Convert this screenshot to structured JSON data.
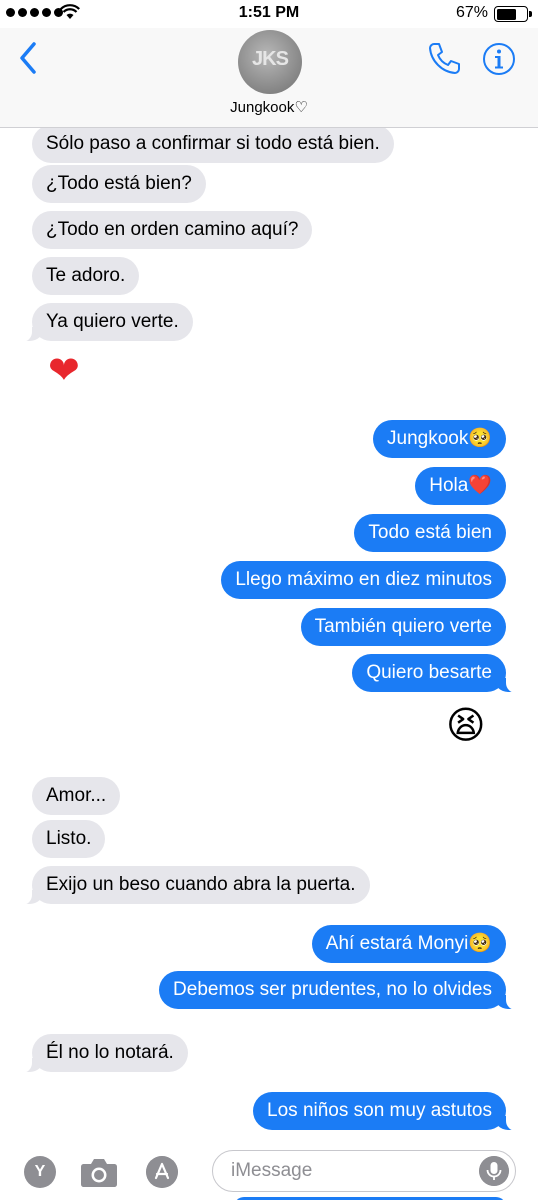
{
  "status_bar": {
    "time": "1:51 PM",
    "battery_percent": "67%",
    "battery_level": 0.67
  },
  "header": {
    "contact_name": "Jungkook♡",
    "avatar_text": "JKS"
  },
  "messages": [
    {
      "side": "in",
      "text": "Sólo paso a confirmar si todo está bien.",
      "top": 0
    },
    {
      "side": "in",
      "text": "¿Todo está bien?"
    },
    {
      "side": "in",
      "text": "¿Todo en orden camino aquí?"
    },
    {
      "side": "in",
      "text": "Te adoro."
    },
    {
      "side": "in",
      "text": "Ya quiero verte."
    },
    {
      "side": "out",
      "text": "Jungkook🥺"
    },
    {
      "side": "out",
      "text": "Hola❤️"
    },
    {
      "side": "out",
      "text": "Todo está bien"
    },
    {
      "side": "out",
      "text": "Llego máximo en diez minutos"
    },
    {
      "side": "out",
      "text": "También quiero verte"
    },
    {
      "side": "out",
      "text": "Quiero besarte"
    },
    {
      "side": "in",
      "text": "Amor..."
    },
    {
      "side": "in",
      "text": "Listo."
    },
    {
      "side": "in",
      "text": "Exijo un beso cuando abra la puerta."
    },
    {
      "side": "out",
      "text": "Ahí estará Monyi🥺"
    },
    {
      "side": "out",
      "text": "Debemos ser prudentes, no lo olvides"
    },
    {
      "side": "in",
      "text": "Él no lo notará."
    },
    {
      "side": "out",
      "text": "Los niños son muy astutos"
    }
  ],
  "emoji_messages": {
    "heart": "❤",
    "tired": "😫"
  },
  "input": {
    "placeholder": "iMessage",
    "value": ""
  },
  "apps": {
    "first_app_letter": "Y"
  },
  "colors": {
    "outgoing_bubble": "#1b7cf5",
    "incoming_bubble": "#e6e6eb",
    "tint": "#1b7cf5"
  }
}
